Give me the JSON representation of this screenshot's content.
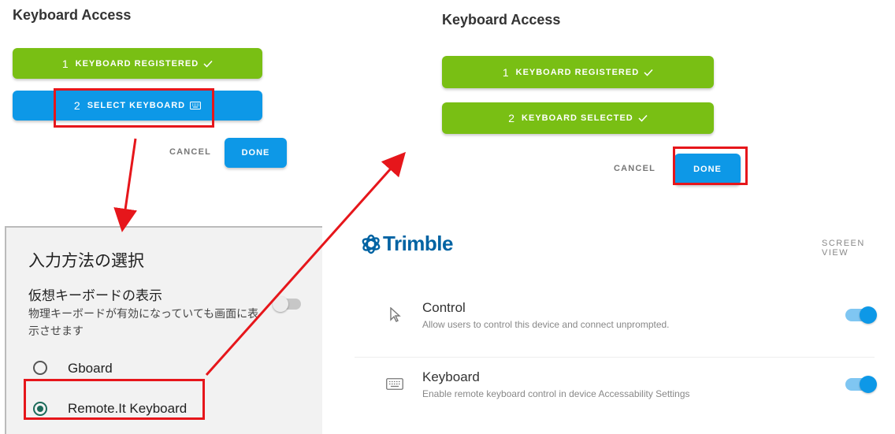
{
  "left_dialog": {
    "title": "Keyboard Access",
    "step1": {
      "number": "1",
      "label": "KEYBOARD REGISTERED",
      "icon": "check-icon",
      "color": "#79bf14"
    },
    "step2": {
      "number": "2",
      "label": "SELECT KEYBOARD",
      "icon": "keyboard-icon",
      "color": "#0d98e7"
    },
    "cancel_label": "CANCEL",
    "done_label": "DONE"
  },
  "right_dialog": {
    "title": "Keyboard Access",
    "step1": {
      "number": "1",
      "label": "KEYBOARD REGISTERED",
      "icon": "check-icon",
      "color": "#79bf14"
    },
    "step2": {
      "number": "2",
      "label": "KEYBOARD SELECTED",
      "icon": "check-icon",
      "color": "#79bf14"
    },
    "cancel_label": "CANCEL",
    "done_label": "DONE"
  },
  "input_method_picker": {
    "title": "入力方法の選択",
    "virtual_keyboard": {
      "label": "仮想キーボードの表示",
      "description": "物理キーボードが有効になっていても画面に表示させます",
      "enabled": false
    },
    "options": [
      {
        "label": "Gboard",
        "selected": false
      },
      {
        "label": "Remote.It Keyboard",
        "selected": true
      }
    ]
  },
  "trimble_settings": {
    "brand": "Trimble",
    "screen_view_label": "SCREEN VIEW",
    "settings": [
      {
        "icon": "cursor-icon",
        "title": "Control",
        "description": "Allow users to control this device and connect unprompted.",
        "enabled": true
      },
      {
        "icon": "keyboard-icon",
        "title": "Keyboard",
        "description": "Enable remote keyboard control in device Accessability Settings",
        "enabled": true
      }
    ]
  },
  "colors": {
    "annotation_red": "#e6161b",
    "accent_blue": "#0d98e7",
    "success_green": "#79bf14",
    "trimble_blue": "#0063a3"
  }
}
